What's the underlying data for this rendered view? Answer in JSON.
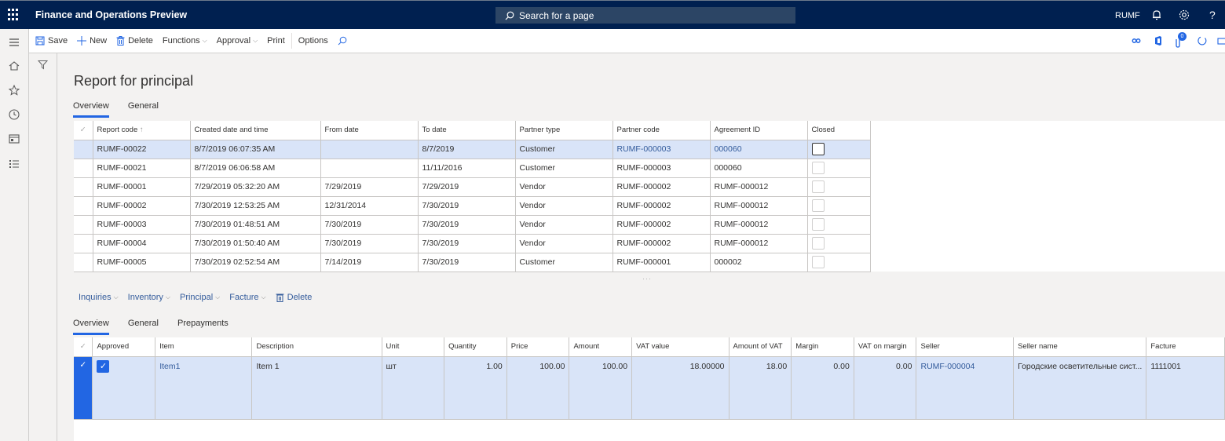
{
  "app": {
    "title": "Finance and Operations Preview",
    "search_placeholder": "Search for a page",
    "company": "RUMF"
  },
  "actionpane": {
    "save": "Save",
    "new": "New",
    "delete": "Delete",
    "functions": "Functions",
    "approval": "Approval",
    "print": "Print",
    "options": "Options",
    "notification_count": "0"
  },
  "page": {
    "title": "Report for principal",
    "tabs": [
      "Overview",
      "General"
    ]
  },
  "header_grid": {
    "columns": [
      "Report code",
      "Created date and time",
      "From date",
      "To date",
      "Partner type",
      "Partner code",
      "Agreement ID",
      "Closed"
    ],
    "sort_indicator": "↑",
    "rows": [
      {
        "report_code": "RUMF-00022",
        "created": "8/7/2019 06:07:35 AM",
        "from": "",
        "to": "8/7/2019",
        "partner_type": "Customer",
        "partner_code": "RUMF-000003",
        "agreement": "000060",
        "closed": false,
        "selected": true
      },
      {
        "report_code": "RUMF-00021",
        "created": "8/7/2019 06:06:58 AM",
        "from": "",
        "to": "11/11/2016",
        "partner_type": "Customer",
        "partner_code": "RUMF-000003",
        "agreement": "000060",
        "closed": false,
        "selected": false
      },
      {
        "report_code": "RUMF-00001",
        "created": "7/29/2019 05:32:20 AM",
        "from": "7/29/2019",
        "to": "7/29/2019",
        "partner_type": "Vendor",
        "partner_code": "RUMF-000002",
        "agreement": "RUMF-000012",
        "closed": false,
        "selected": false
      },
      {
        "report_code": "RUMF-00002",
        "created": "7/30/2019 12:53:25 AM",
        "from": "12/31/2014",
        "to": "7/30/2019",
        "partner_type": "Vendor",
        "partner_code": "RUMF-000002",
        "agreement": "RUMF-000012",
        "closed": false,
        "selected": false
      },
      {
        "report_code": "RUMF-00003",
        "created": "7/30/2019 01:48:51 AM",
        "from": "7/30/2019",
        "to": "7/30/2019",
        "partner_type": "Vendor",
        "partner_code": "RUMF-000002",
        "agreement": "RUMF-000012",
        "closed": false,
        "selected": false
      },
      {
        "report_code": "RUMF-00004",
        "created": "7/30/2019 01:50:40 AM",
        "from": "7/30/2019",
        "to": "7/30/2019",
        "partner_type": "Vendor",
        "partner_code": "RUMF-000002",
        "agreement": "RUMF-000012",
        "closed": false,
        "selected": false
      },
      {
        "report_code": "RUMF-00005",
        "created": "7/30/2019 02:52:54 AM",
        "from": "7/14/2019",
        "to": "7/30/2019",
        "partner_type": "Customer",
        "partner_code": "RUMF-000001",
        "agreement": "000002",
        "closed": false,
        "selected": false
      }
    ]
  },
  "lines": {
    "toolbar": [
      "Inquiries",
      "Inventory",
      "Principal",
      "Facture",
      "Delete"
    ],
    "tabs": [
      "Overview",
      "General",
      "Prepayments"
    ],
    "columns": [
      "Approved",
      "Item",
      "Description",
      "Unit",
      "Quantity",
      "Price",
      "Amount",
      "VAT value",
      "Amount of VAT",
      "Margin",
      "VAT on margin",
      "Seller",
      "Seller name",
      "Facture"
    ],
    "rows": [
      {
        "approved": true,
        "item": "Item1",
        "description": "Item 1",
        "unit": "шт",
        "quantity": "1.00",
        "price": "100.00",
        "amount": "100.00",
        "vat_value": "18.00000",
        "amount_of_vat": "18.00",
        "margin": "0.00",
        "vat_on_margin": "0.00",
        "seller": "RUMF-000004",
        "seller_name": "Городские осветительные сист...",
        "facture": "1111001"
      }
    ]
  },
  "colors": {
    "nav": "#002050",
    "accent": "#2266e3",
    "selected_row": "#d9e4f8",
    "link": "#345c9c"
  }
}
